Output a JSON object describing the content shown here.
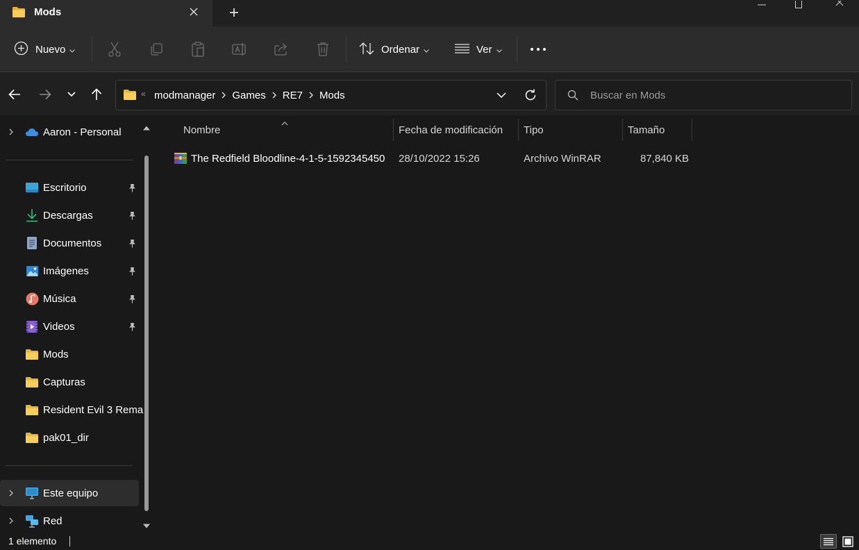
{
  "window": {
    "tab_title": "Mods",
    "tab_icon": "folder-icon",
    "new_tab_symbol": "+",
    "controls": [
      "minimize",
      "maximize",
      "close"
    ]
  },
  "toolbar": {
    "new_label": "Nuevo",
    "sort_label": "Ordenar",
    "view_label": "Ver",
    "icons": [
      "cut-icon",
      "copy-icon",
      "paste-icon",
      "rename-icon",
      "share-icon",
      "delete-icon",
      "more-icon"
    ]
  },
  "address": {
    "overflow": "«",
    "crumbs": [
      "modmanager",
      "Games",
      "RE7",
      "Mods"
    ]
  },
  "search": {
    "placeholder": "Buscar en Mods"
  },
  "sidebar": {
    "cloud": {
      "label": "Aaron - Personal",
      "icon": "onedrive-icon"
    },
    "quick_access": [
      {
        "label": "Escritorio",
        "icon": "desktop-icon",
        "pinned": true
      },
      {
        "label": "Descargas",
        "icon": "download-icon",
        "pinned": true
      },
      {
        "label": "Documentos",
        "icon": "documents-icon",
        "pinned": true
      },
      {
        "label": "Imágenes",
        "icon": "pictures-icon",
        "pinned": true
      },
      {
        "label": "Música",
        "icon": "music-icon",
        "pinned": true
      },
      {
        "label": "Videos",
        "icon": "videos-icon",
        "pinned": true
      },
      {
        "label": "Mods",
        "icon": "folder-icon",
        "pinned": false
      },
      {
        "label": "Capturas",
        "icon": "folder-icon",
        "pinned": false
      },
      {
        "label": "Resident Evil 3 Rema",
        "icon": "folder-icon",
        "pinned": false
      },
      {
        "label": "pak01_dir",
        "icon": "folder-icon",
        "pinned": false
      }
    ],
    "this_pc": {
      "label": "Este equipo",
      "icon": "computer-icon"
    },
    "network": {
      "label": "Red",
      "icon": "network-icon"
    }
  },
  "columns": {
    "name": "Nombre",
    "modified": "Fecha de modificación",
    "type": "Tipo",
    "size": "Tamaño"
  },
  "files": [
    {
      "name": "The Redfield Bloodline-4-1-5-1592345450",
      "modified": "28/10/2022 15:26",
      "type": "Archivo WinRAR",
      "size": "87,840 KB",
      "icon": "winrar-icon"
    }
  ],
  "status": {
    "count": "1 elemento",
    "views": [
      "details-view-icon",
      "tiles-view-icon"
    ]
  },
  "colors": {
    "folder_yellow": "#f2c14e",
    "background": "#191919",
    "commandbar": "#2c2c2c"
  }
}
